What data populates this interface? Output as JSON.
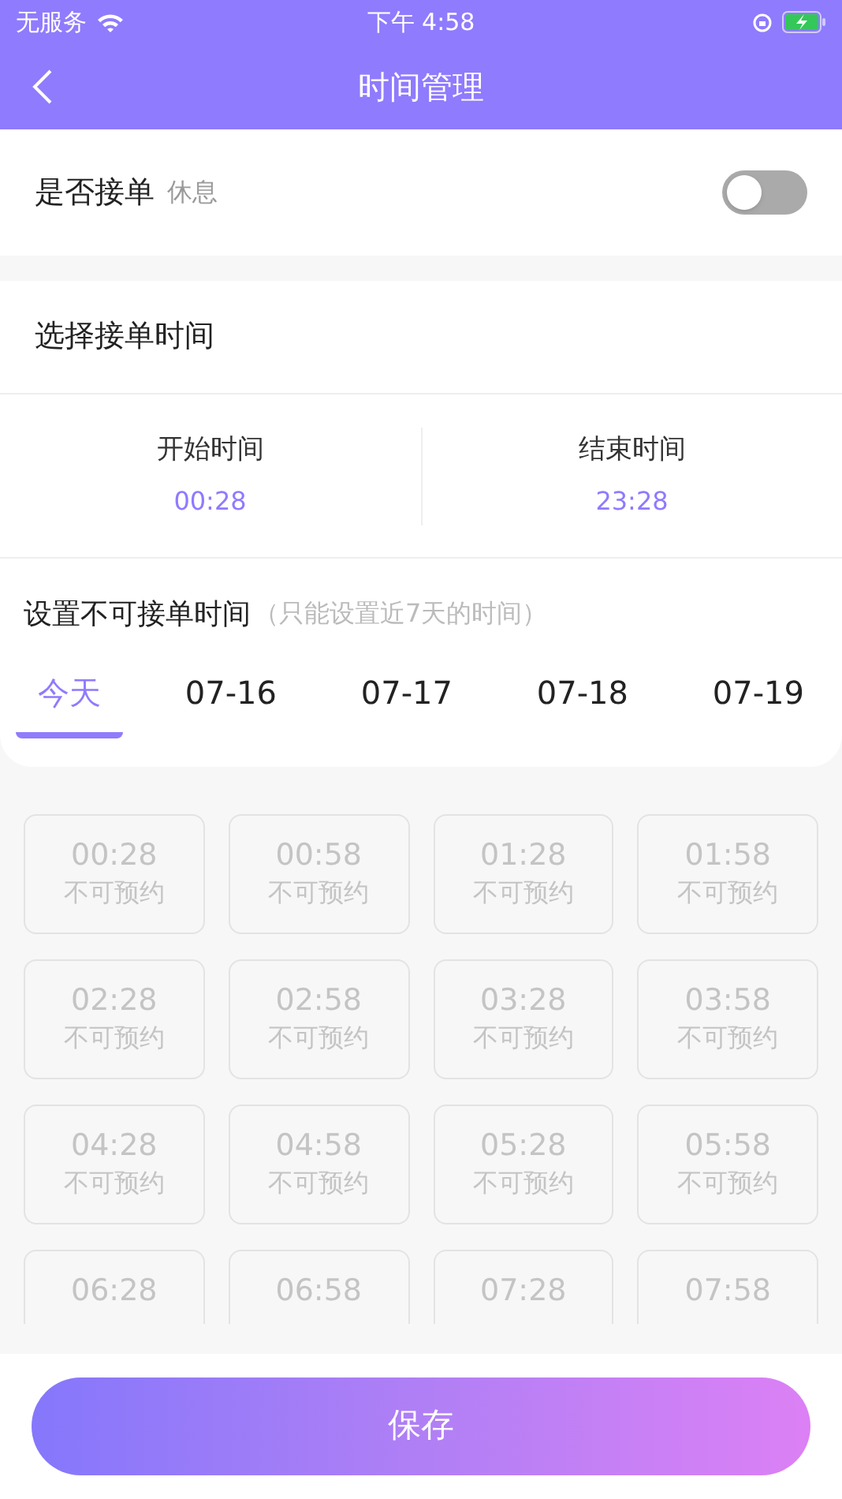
{
  "status_bar": {
    "carrier": "无服务",
    "time": "下午 4:58"
  },
  "nav": {
    "title": "时间管理"
  },
  "accept_orders": {
    "label": "是否接单",
    "status": "休息",
    "on": false
  },
  "time_range": {
    "title": "选择接单时间",
    "start": {
      "label": "开始时间",
      "value": "00:28"
    },
    "end": {
      "label": "结束时间",
      "value": "23:28"
    }
  },
  "unavailable": {
    "title": "设置不可接单时间",
    "hint": "（只能设置近7天的时间）"
  },
  "tabs": [
    {
      "label": "今天",
      "selected": true
    },
    {
      "label": "07-16",
      "selected": false
    },
    {
      "label": "07-17",
      "selected": false
    },
    {
      "label": "07-18",
      "selected": false
    },
    {
      "label": "07-19",
      "selected": false
    }
  ],
  "slots": [
    {
      "time": "00:28",
      "status": "不可预约",
      "disabled": true
    },
    {
      "time": "00:58",
      "status": "不可预约",
      "disabled": true
    },
    {
      "time": "01:28",
      "status": "不可预约",
      "disabled": true
    },
    {
      "time": "01:58",
      "status": "不可预约",
      "disabled": true
    },
    {
      "time": "02:28",
      "status": "不可预约",
      "disabled": true
    },
    {
      "time": "02:58",
      "status": "不可预约",
      "disabled": true
    },
    {
      "time": "03:28",
      "status": "不可预约",
      "disabled": true
    },
    {
      "time": "03:58",
      "status": "不可预约",
      "disabled": true
    },
    {
      "time": "04:28",
      "status": "不可预约",
      "disabled": true
    },
    {
      "time": "04:58",
      "status": "不可预约",
      "disabled": true
    },
    {
      "time": "05:28",
      "status": "不可预约",
      "disabled": true
    },
    {
      "time": "05:58",
      "status": "不可预约",
      "disabled": true
    },
    {
      "time": "06:28",
      "disabled": true
    },
    {
      "time": "06:58",
      "disabled": true
    },
    {
      "time": "07:28",
      "disabled": true
    },
    {
      "time": "07:58",
      "disabled": true
    }
  ],
  "save_button": {
    "label": "保存"
  }
}
